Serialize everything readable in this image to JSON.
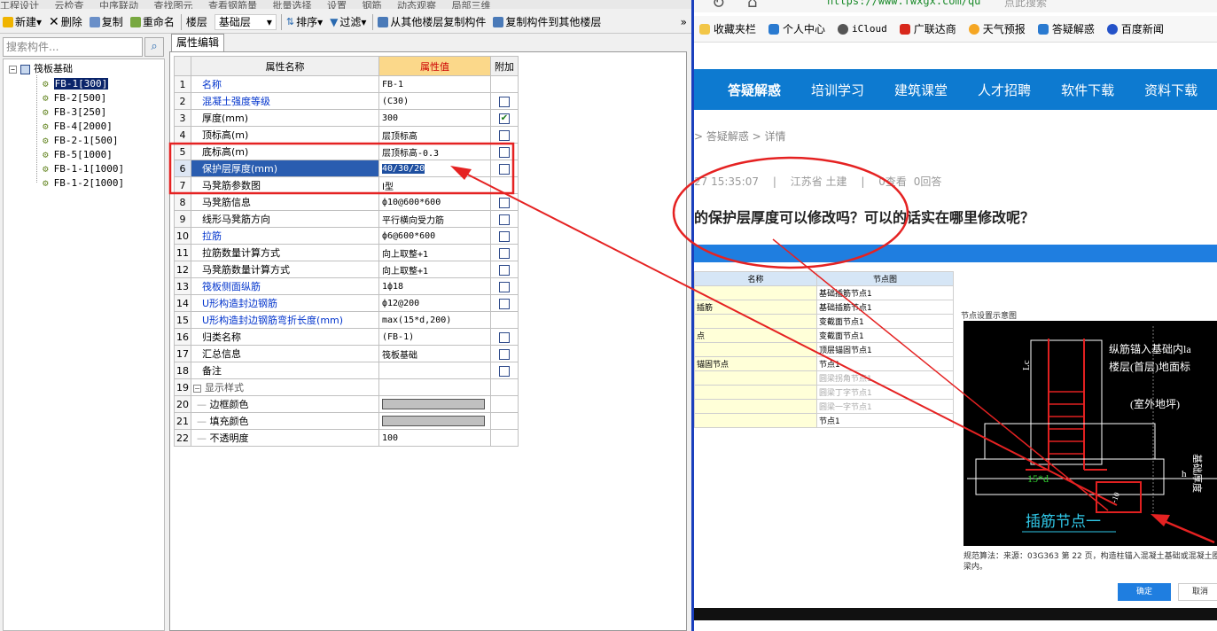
{
  "toolbar": {
    "top_fragments": [
      "工程设计",
      "云检查",
      "中序联动",
      "查找图元",
      "查看钢筋量",
      "批量选择",
      "设置",
      "钢筋",
      "动态观察",
      "局部三维"
    ],
    "new": "新建",
    "delete": "删除",
    "copy": "复制",
    "rename": "重命名",
    "floor_label": "楼层",
    "floor_value": "基础层",
    "sort": "排序",
    "filter": "过滤",
    "copy_from_other": "从其他楼层复制构件",
    "copy_to_other": "复制构件到其他楼层",
    "more": "»"
  },
  "search": {
    "placeholder": "搜索构件..."
  },
  "tree": {
    "root": "筏板基础",
    "items": [
      "FB-1[300]",
      "FB-2[500]",
      "FB-3[250]",
      "FB-4[2000]",
      "FB-2-1[500]",
      "FB-5[1000]",
      "FB-1-1[1000]",
      "FB-1-2[1000]"
    ]
  },
  "props": {
    "tab": "属性编辑",
    "col_name": "属性名称",
    "col_value": "属性值",
    "col_add": "附加",
    "rows": [
      {
        "n": "1",
        "name": "名称",
        "value": "FB-1",
        "blue": true,
        "cb": "none"
      },
      {
        "n": "2",
        "name": "混凝土强度等级",
        "value": "(C30)",
        "blue": true,
        "cb": "off"
      },
      {
        "n": "3",
        "name": "厚度(mm)",
        "value": "300",
        "blue": false,
        "cb": "on"
      },
      {
        "n": "4",
        "name": "顶标高(m)",
        "value": "层顶标高",
        "blue": false,
        "cb": "off"
      },
      {
        "n": "5",
        "name": "底标高(m)",
        "value": "层顶标高-0.3",
        "blue": false,
        "cb": "off"
      },
      {
        "n": "6",
        "name": "保护层厚度(mm)",
        "value": "40/30/20",
        "blue": false,
        "cb": "off",
        "selected": true
      },
      {
        "n": "7",
        "name": "马凳筋参数图",
        "value": "Ⅰ型",
        "blue": false,
        "cb": "none"
      },
      {
        "n": "8",
        "name": "马凳筋信息",
        "value": "ф10@600*600",
        "blue": false,
        "cb": "off"
      },
      {
        "n": "9",
        "name": "线形马凳筋方向",
        "value": "平行横向受力筋",
        "blue": false,
        "cb": "off"
      },
      {
        "n": "10",
        "name": "拉筋",
        "value": "ф6@600*600",
        "blue": true,
        "cb": "off"
      },
      {
        "n": "11",
        "name": "拉筋数量计算方式",
        "value": "向上取整+1",
        "blue": false,
        "cb": "off"
      },
      {
        "n": "12",
        "name": "马凳筋数量计算方式",
        "value": "向上取整+1",
        "blue": false,
        "cb": "off"
      },
      {
        "n": "13",
        "name": "筏板侧面纵筋",
        "value": "1ф18",
        "blue": true,
        "cb": "off"
      },
      {
        "n": "14",
        "name": "U形构造封边钢筋",
        "value": "ф12@200",
        "blue": true,
        "cb": "off"
      },
      {
        "n": "15",
        "name": "U形构造封边钢筋弯折长度(mm)",
        "value": "max(15*d,200)",
        "blue": true,
        "cb": "none"
      },
      {
        "n": "16",
        "name": "归类名称",
        "value": "(FB-1)",
        "blue": false,
        "cb": "off"
      },
      {
        "n": "17",
        "name": "汇总信息",
        "value": "筏板基础",
        "blue": false,
        "cb": "off"
      },
      {
        "n": "18",
        "name": "备注",
        "value": "",
        "blue": false,
        "cb": "off"
      }
    ],
    "group": {
      "n": "19",
      "name": "显示样式"
    },
    "sub_rows": [
      {
        "n": "20",
        "name": "边框颜色",
        "swatch": true
      },
      {
        "n": "21",
        "name": "填充颜色",
        "swatch": true
      },
      {
        "n": "22",
        "name": "不透明度",
        "value": "100"
      }
    ]
  },
  "browser": {
    "url": "https://www.fwxgx.com/qu",
    "search_placeholder": "点此搜索",
    "bookmarks": [
      "收藏夹栏",
      "个人中心",
      "iCloud",
      "广联达商",
      "天气预报",
      "答疑解惑",
      "百度新闻"
    ],
    "nav": [
      "答疑解惑",
      "培训学习",
      "建筑课堂",
      "人才招聘",
      "软件下载",
      "资料下载"
    ],
    "breadcrumb": "> 答疑解惑 > 详情",
    "meta": {
      "time": "27 15:35:07",
      "location": "江苏省 土建",
      "views": "0查看",
      "answers": "0回答"
    },
    "question": "的保护层厚度可以修改吗？可以的话实在哪里修改呢？",
    "node_table": {
      "col_name": "名称",
      "col_node": "节点图",
      "rows": [
        {
          "name": "",
          "node": "基础插筋节点1",
          "grey": false
        },
        {
          "name": "插筋",
          "node": "基础插筋节点1",
          "grey": false
        },
        {
          "name": "",
          "node": "变截面节点1",
          "grey": false
        },
        {
          "name": "点",
          "node": "变截面节点1",
          "grey": false
        },
        {
          "name": "",
          "node": "顶层锚固节点1",
          "grey": false
        },
        {
          "name": "锚固节点",
          "node": "节点1",
          "grey": false
        },
        {
          "name": "",
          "node": "圆梁拐角节点1",
          "grey": true
        },
        {
          "name": "",
          "node": "圆梁丁字节点1",
          "grey": true
        },
        {
          "name": "",
          "node": "圆梁一字节点1",
          "grey": true
        },
        {
          "name": "",
          "node": "节点1",
          "grey": false
        }
      ]
    },
    "diagram_title": "节点设置示意图",
    "diagram_texts": {
      "t1": "纵筋锚入基础内la",
      "t2": "楼层(首层)地面标",
      "t3": "(室外地坪)",
      "lc": "Lc",
      "d15": "15*d",
      "h": "h",
      "thick": "基础厚度",
      "caption": "插筋节点一",
      "small": "-10"
    },
    "note": "规范算法：来源：03G363 第 22 页，构造柱锚入混凝土基础或混凝土圈梁内。",
    "ok": "确定",
    "cancel": "取消"
  }
}
